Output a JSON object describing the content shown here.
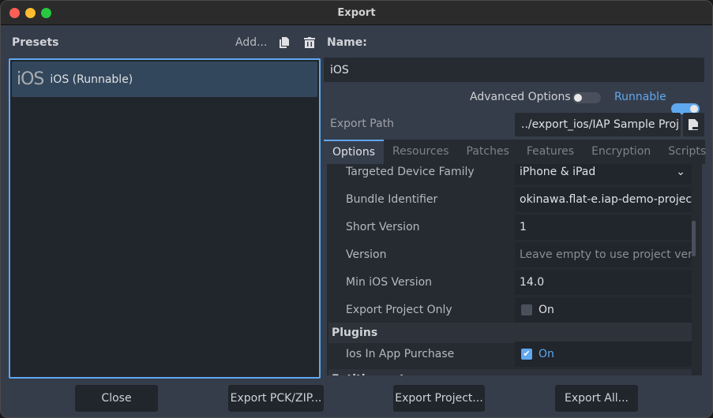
{
  "window": {
    "title": "Export"
  },
  "presets": {
    "label": "Presets",
    "add_label": "Add...",
    "items": [
      {
        "icon": "iOS",
        "label": "iOS (Runnable)"
      }
    ]
  },
  "details": {
    "name_label": "Name:",
    "name_value": "iOS",
    "advanced_label": "Advanced Options",
    "advanced_on": false,
    "runnable_label": "Runnable",
    "runnable_on": true,
    "export_path_label": "Export Path",
    "export_path_value": "../export_ios/IAP Sample Proj",
    "tabs": [
      "Options",
      "Resources",
      "Patches",
      "Features",
      "Encryption",
      "Scripts"
    ],
    "options": [
      {
        "key": "Targeted Device Family",
        "value": "iPhone & iPad"
      },
      {
        "key": "Bundle Identifier",
        "value": "okinawa.flat-e.iap-demo-projec"
      },
      {
        "key": "Short Version",
        "value": "1"
      },
      {
        "key": "Version",
        "value": "Leave empty to use project vers"
      },
      {
        "key": "Min iOS Version",
        "value": "14.0"
      },
      {
        "key": "Export Project Only",
        "value": "On",
        "checked": false
      }
    ],
    "plugins_label": "Plugins",
    "plugin": {
      "key": "Ios In App Purchase",
      "value": "On",
      "checked": true
    },
    "entitlements_label": "Entitlements"
  },
  "buttons": {
    "close": "Close",
    "export_pck": "Export PCK/ZIP...",
    "export_project": "Export Project...",
    "export_all": "Export All..."
  },
  "colors": {
    "accent": "#5fa8ef",
    "bg": "#363d4a"
  }
}
